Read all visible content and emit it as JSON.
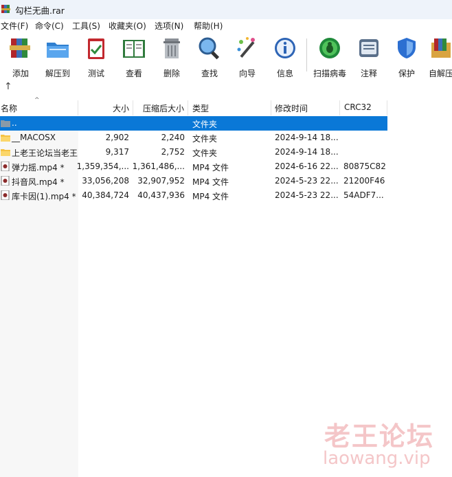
{
  "window": {
    "title": "勾栏无曲.rar"
  },
  "menu": [
    "文件(F)",
    "命令(C)",
    "工具(S)",
    "收藏夹(O)",
    "选项(N)",
    "帮助(H)"
  ],
  "toolbar": [
    {
      "label": "添加",
      "icon": "books-add-icon"
    },
    {
      "label": "解压到",
      "icon": "folder-extract-icon"
    },
    {
      "label": "测试",
      "icon": "clipboard-test-icon"
    },
    {
      "label": "查看",
      "icon": "book-view-icon"
    },
    {
      "label": "删除",
      "icon": "trash-icon"
    },
    {
      "label": "查找",
      "icon": "magnifier-icon"
    },
    {
      "label": "向导",
      "icon": "magic-wand-icon"
    },
    {
      "label": "信息",
      "icon": "info-icon"
    },
    {
      "label": "扫描病毒",
      "icon": "virus-scan-icon"
    },
    {
      "label": "注释",
      "icon": "comment-icon"
    },
    {
      "label": "保护",
      "icon": "shield-icon"
    },
    {
      "label": "自解压",
      "icon": "sfx-icon"
    }
  ],
  "up_glyph": "↑",
  "columns": {
    "name": "名称",
    "size": "大小",
    "packed": "压缩后大小",
    "type": "类型",
    "modified": "修改时间",
    "crc": "CRC32"
  },
  "rows": [
    {
      "name": "..",
      "size": "",
      "packed": "",
      "type": "文件夹",
      "modified": "",
      "crc": "",
      "kind": "up"
    },
    {
      "name": "__MACOSX",
      "size": "2,902",
      "packed": "2,240",
      "type": "文件夹",
      "modified": "2024-9-14 18...",
      "crc": "",
      "kind": "folder"
    },
    {
      "name": "上老王论坛当老王",
      "size": "9,317",
      "packed": "2,752",
      "type": "文件夹",
      "modified": "2024-9-14 18...",
      "crc": "",
      "kind": "folder"
    },
    {
      "name": "弹力摇.mp4 *",
      "size": "1,359,354,...",
      "packed": "1,361,486,...",
      "type": "MP4 文件",
      "modified": "2024-6-16 22...",
      "crc": "80875C82",
      "kind": "video"
    },
    {
      "name": "抖音风.mp4 *",
      "size": "33,056,208",
      "packed": "32,907,952",
      "type": "MP4 文件",
      "modified": "2024-5-23 22...",
      "crc": "21200F46",
      "kind": "video"
    },
    {
      "name": "库卡因(1).mp4 *",
      "size": "40,384,724",
      "packed": "40,437,936",
      "type": "MP4 文件",
      "modified": "2024-5-23 22...",
      "crc": "54ADF7...",
      "kind": "video"
    }
  ],
  "watermark": {
    "cn": "老王论坛",
    "url": "laowang.vip"
  }
}
